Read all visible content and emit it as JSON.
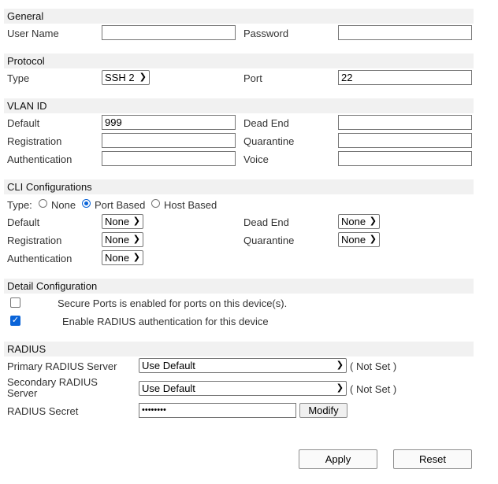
{
  "general": {
    "header": "General",
    "username_label": "User Name",
    "username_value": "",
    "password_label": "Password",
    "password_value": ""
  },
  "protocol": {
    "header": "Protocol",
    "type_label": "Type",
    "type_value": "SSH 2",
    "port_label": "Port",
    "port_value": "22"
  },
  "vlan": {
    "header": "VLAN ID",
    "default_label": "Default",
    "default_value": "999",
    "dead_end_label": "Dead End",
    "dead_end_value": "",
    "registration_label": "Registration",
    "registration_value": "",
    "quarantine_label": "Quarantine",
    "quarantine_value": "",
    "authentication_label": "Authentication",
    "authentication_value": "",
    "voice_label": "Voice",
    "voice_value": ""
  },
  "cli": {
    "header": "CLI Configurations",
    "type_label": "Type:",
    "radio_none": "None",
    "radio_port": "Port Based",
    "radio_host": "Host Based",
    "selected_radio": "Port Based",
    "default_label": "Default",
    "default_value": "None",
    "dead_end_label": "Dead End",
    "dead_end_value": "None",
    "registration_label": "Registration",
    "registration_value": "None",
    "quarantine_label": "Quarantine",
    "quarantine_value": "None",
    "authentication_label": "Authentication",
    "authentication_value": "None"
  },
  "detail": {
    "header": "Detail Configuration",
    "secure_ports_text": "Secure Ports is enabled for ports on this device(s).",
    "secure_ports_checked": false,
    "radius_auth_text": "Enable RADIUS authentication for this device",
    "radius_auth_checked": true
  },
  "radius": {
    "header": "RADIUS",
    "primary_label": "Primary RADIUS Server",
    "primary_value": "Use Default",
    "primary_status": "( Not Set )",
    "secondary_label_line1": "Secondary RADIUS",
    "secondary_label_line2": "Server",
    "secondary_value": "Use Default",
    "secondary_status": "( Not Set )",
    "secret_label": "RADIUS Secret",
    "secret_value": "••••••••",
    "modify_button": "Modify"
  },
  "actions": {
    "apply_button": "Apply",
    "reset_button": "Reset"
  },
  "colors": {
    "accent": "#0a64d8",
    "section_background": "#f1f1f1"
  }
}
